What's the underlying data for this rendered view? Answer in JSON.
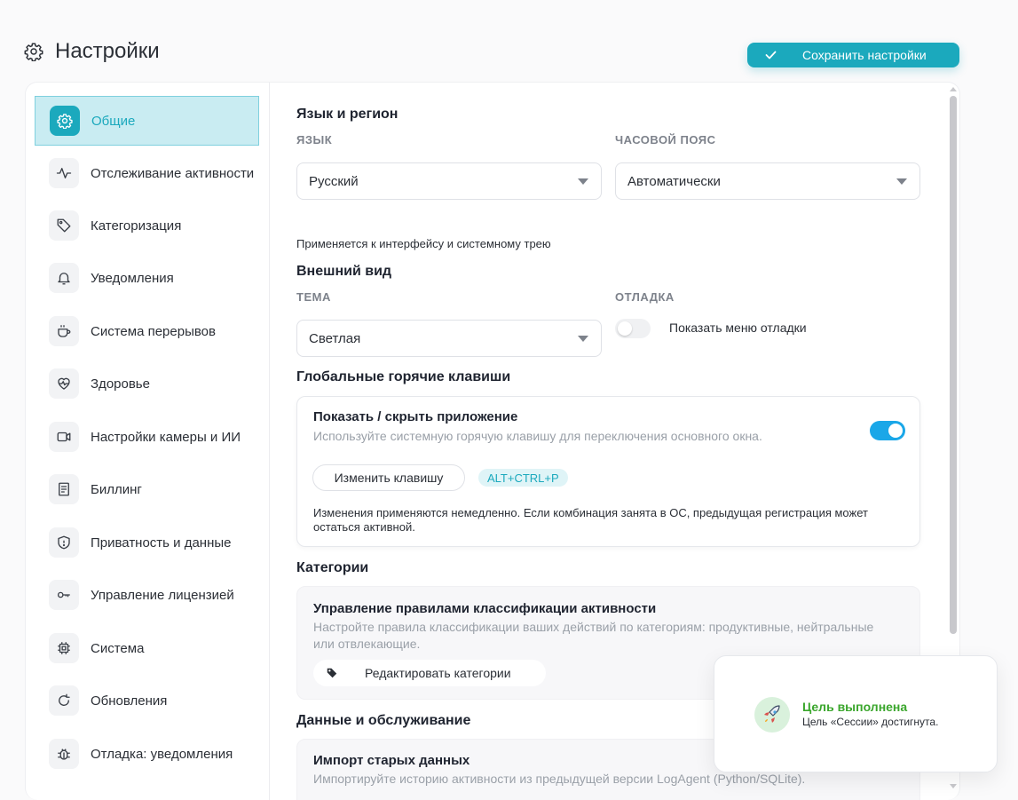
{
  "header": {
    "title": "Настройки",
    "save_label": "Сохранить настройки"
  },
  "sidebar": {
    "items": [
      {
        "label": "Общие",
        "icon": "gear-icon",
        "active": true
      },
      {
        "label": "Отслеживание активности",
        "icon": "activity-icon"
      },
      {
        "label": "Категоризация",
        "icon": "tag-icon"
      },
      {
        "label": "Уведомления",
        "icon": "bell-icon"
      },
      {
        "label": "Система перерывов",
        "icon": "coffee-icon"
      },
      {
        "label": "Здоровье",
        "icon": "heart-pulse-icon"
      },
      {
        "label": "Настройки камеры и ИИ",
        "icon": "camera-icon"
      },
      {
        "label": "Биллинг",
        "icon": "receipt-icon"
      },
      {
        "label": "Приватность и данные",
        "icon": "shield-icon"
      },
      {
        "label": "Управление лицензией",
        "icon": "key-icon"
      },
      {
        "label": "Система",
        "icon": "chip-icon"
      },
      {
        "label": "Обновления",
        "icon": "refresh-icon"
      },
      {
        "label": "Отладка: уведомления",
        "icon": "bug-icon"
      }
    ]
  },
  "language": {
    "section_title": "Язык и регион",
    "lang_label": "ЯЗЫК",
    "lang_value": "Русский",
    "tz_label": "ЧАСОВОЙ ПОЯС",
    "tz_value": "Автоматически",
    "hint": "Применяется к интерфейсу и системному трею"
  },
  "appearance": {
    "section_title": "Внешний вид",
    "theme_label": "ТЕМА",
    "theme_value": "Светлая",
    "debug_label": "ОТЛАДКА",
    "debug_toggle_label": "Показать меню отладки",
    "debug_enabled": false
  },
  "hotkeys": {
    "section_title": "Глобальные горячие клавиши",
    "card_title": "Показать / скрыть приложение",
    "card_desc": "Используйте системную горячую клавишу для переключения основного окна.",
    "enabled": true,
    "change_label": "Изменить клавишу",
    "key": "ALT+CTRL+P",
    "note": "Изменения применяются немедленно. Если комбинация занята в ОС, предыдущая регистрация может остаться активной."
  },
  "categories": {
    "section_title": "Категории",
    "card_title": "Управление правилами классификации активности",
    "card_desc": "Настройте правила классификации ваших действий по категориям: продуктивные, нейтральные или отвлекающие.",
    "edit_label": "Редактировать категории"
  },
  "data": {
    "section_title": "Данные и обслуживание",
    "card_title": "Импорт старых данных",
    "card_desc": "Импортируйте историю активности из предыдущей версии LogAgent (Python/SQLite)."
  },
  "toast": {
    "title": "Цель выполнена",
    "message": "Цель «Сессии» достигнута.",
    "icon": "rocket-icon"
  },
  "colors": {
    "accent": "#1ba9bd",
    "toggle_on": "#1aa7e8",
    "success": "#3aa62c"
  }
}
